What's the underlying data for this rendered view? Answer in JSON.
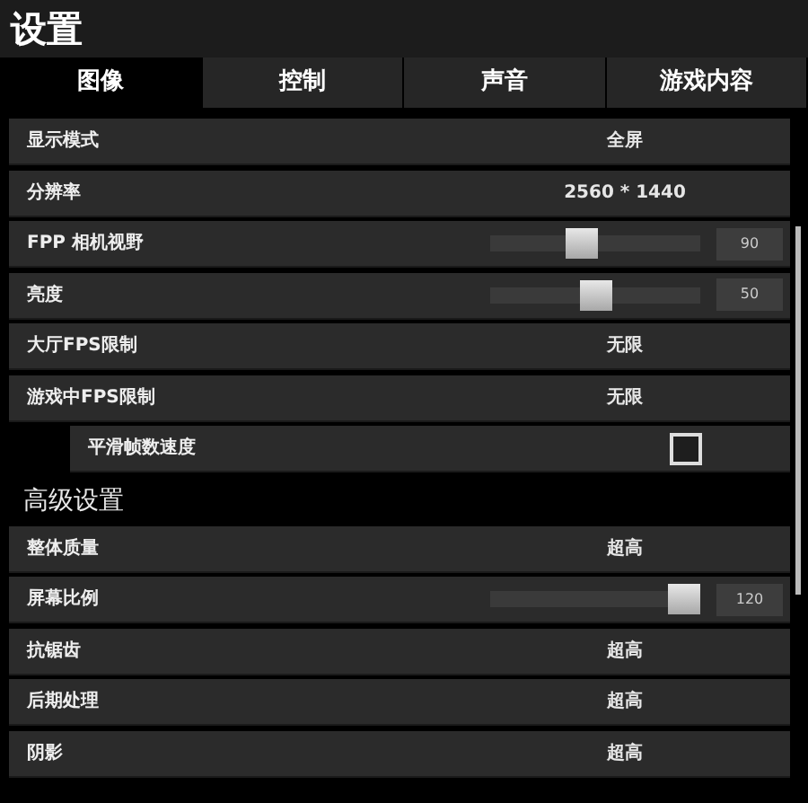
{
  "window": {
    "title": "设置"
  },
  "tabs": [
    {
      "label": "图像",
      "selected": true
    },
    {
      "label": "控制",
      "selected": false
    },
    {
      "label": "声音",
      "selected": false
    },
    {
      "label": "游戏内容",
      "selected": false
    }
  ],
  "rows": [
    {
      "kind": "value",
      "label": "显示模式",
      "value": "全屏"
    },
    {
      "kind": "value",
      "label": "分辨率",
      "value": "2560 * 1440"
    },
    {
      "kind": "slider",
      "label": "FPP 相机视野",
      "level": 0.44,
      "reading": "90"
    },
    {
      "kind": "slider",
      "label": "亮度",
      "level": 0.5,
      "reading": "50"
    },
    {
      "kind": "value",
      "label": "大厅FPS限制",
      "value": "无限"
    },
    {
      "kind": "value",
      "label": "游戏中FPS限制",
      "value": "无限",
      "children": [
        {
          "kind": "checkbox",
          "label": "平滑帧数速度",
          "checked": false
        }
      ]
    },
    {
      "kind": "header",
      "label": "高级设置"
    },
    {
      "kind": "value",
      "label": "整体质量",
      "value": "超高"
    },
    {
      "kind": "slider",
      "label": "屏幕比例",
      "level": 1,
      "reading": "120"
    },
    {
      "kind": "value",
      "label": "抗锯齿",
      "value": "超高"
    },
    {
      "kind": "value",
      "label": "后期处理",
      "value": "超高"
    },
    {
      "kind": "value",
      "label": "阴影",
      "value": "超高"
    }
  ]
}
